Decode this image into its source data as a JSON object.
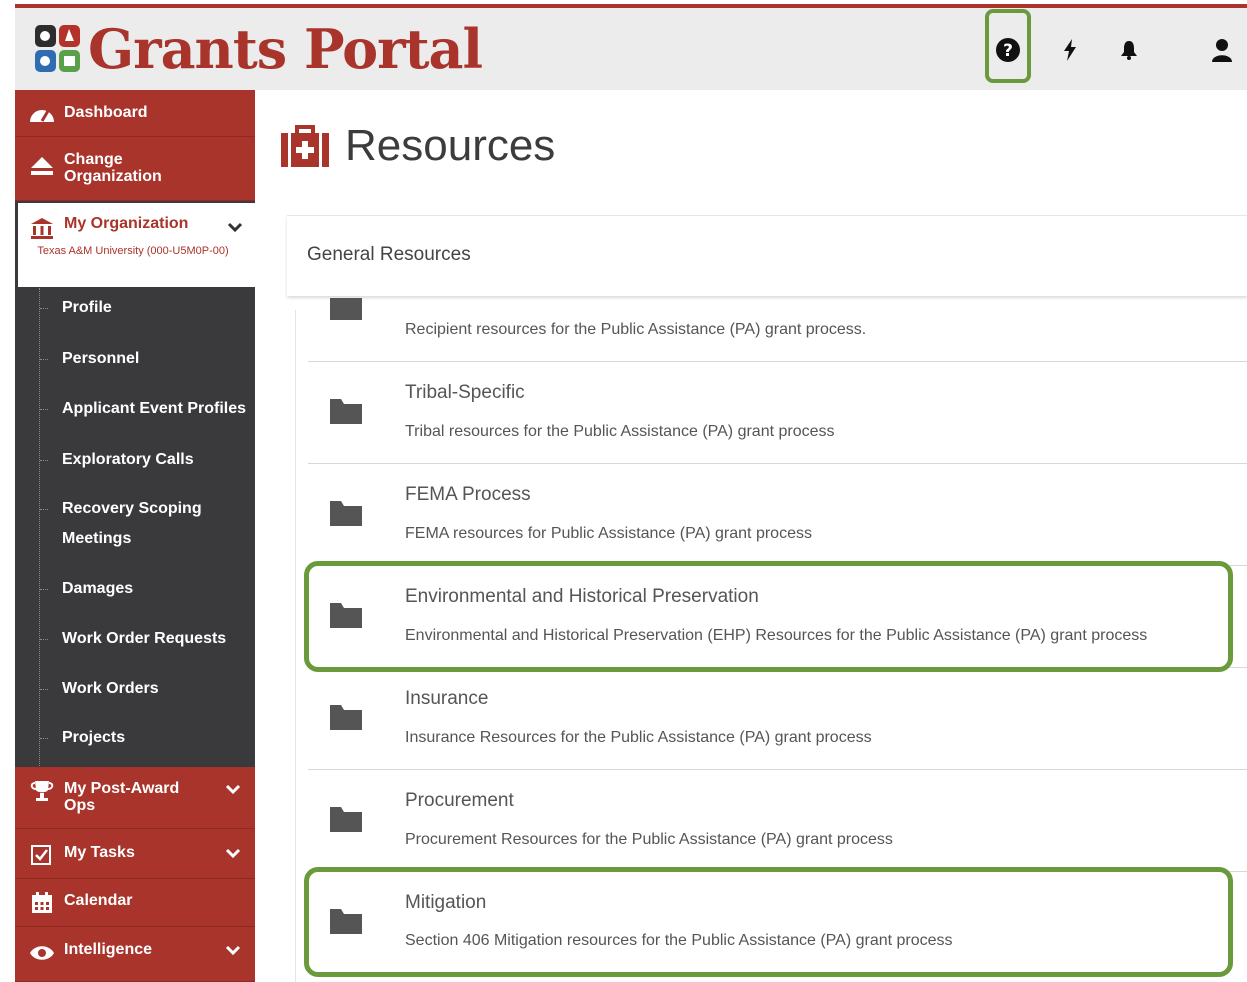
{
  "app": {
    "title": "Grants Portal"
  },
  "header": {
    "icons": [
      "help-icon",
      "bolt-icon",
      "bell-icon",
      "user-icon"
    ]
  },
  "sidebar": {
    "dashboard": "Dashboard",
    "change_org": "Change Organization",
    "my_org": "My Organization",
    "org_name": "Texas A&M University (000-U5M0P-00)",
    "sub_items": [
      "Profile",
      "Personnel",
      "Applicant Event Profiles",
      "Exploratory Calls",
      "Recovery Scoping Meetings",
      "Damages",
      "Work Order Requests",
      "Work Orders",
      "Projects"
    ],
    "post_award": "My Post-Award Ops",
    "tasks": "My Tasks",
    "calendar": "Calendar",
    "intelligence": "Intelligence"
  },
  "main": {
    "title": "Resources",
    "panel_title": "General Resources",
    "partial_desc": "Recipient resources for the Public Assistance (PA) grant process.",
    "rows": [
      {
        "name": "Tribal-Specific",
        "desc": "Tribal resources for the Public Assistance (PA) grant process"
      },
      {
        "name": "FEMA Process",
        "desc": "FEMA resources for Public Assistance (PA) grant process"
      },
      {
        "name": "Environmental and Historical Preservation",
        "desc": "Environmental and Historical Preservation (EHP) Resources for the Public Assistance (PA) grant process"
      },
      {
        "name": "Insurance",
        "desc": "Insurance Resources for the Public Assistance (PA) grant process"
      },
      {
        "name": "Procurement",
        "desc": "Procurement Resources for the Public Assistance (PA) grant process"
      },
      {
        "name": "Mitigation",
        "desc": "Section 406 Mitigation resources for the Public Assistance (PA) grant process"
      }
    ]
  },
  "colors": {
    "brand": "#a8342b",
    "highlight": "#6a9a3c",
    "sidebar_dark": "#3a3a3c"
  }
}
